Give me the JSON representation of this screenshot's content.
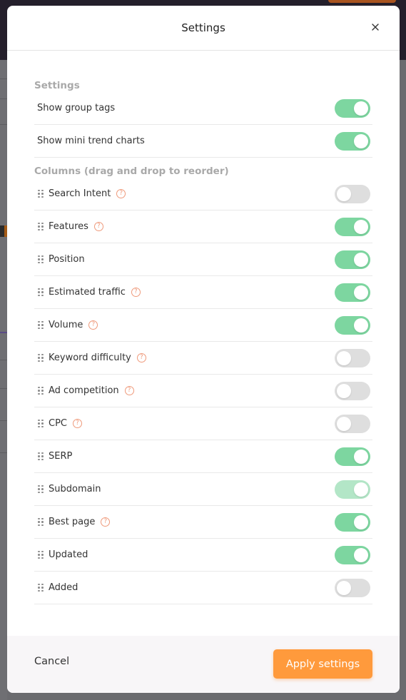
{
  "modal": {
    "title": "Settings",
    "close_icon": "close-icon"
  },
  "settings_section": {
    "title": "Settings",
    "items": [
      {
        "label": "Show group tags",
        "enabled": true
      },
      {
        "label": "Show mini trend charts",
        "enabled": true
      }
    ]
  },
  "columns_section": {
    "title": "Columns (drag and drop to reorder)",
    "items": [
      {
        "label": "Search Intent",
        "help": true,
        "enabled": false
      },
      {
        "label": "Features",
        "help": true,
        "enabled": true
      },
      {
        "label": "Position",
        "help": false,
        "enabled": true
      },
      {
        "label": "Estimated traffic",
        "help": true,
        "enabled": true
      },
      {
        "label": "Volume",
        "help": true,
        "enabled": true
      },
      {
        "label": "Keyword difficulty",
        "help": true,
        "enabled": false
      },
      {
        "label": "Ad competition",
        "help": true,
        "enabled": false
      },
      {
        "label": "CPC",
        "help": true,
        "enabled": false
      },
      {
        "label": "SERP",
        "help": false,
        "enabled": true
      },
      {
        "label": "Subdomain",
        "help": false,
        "enabled": true,
        "disabled": true
      },
      {
        "label": "Best page",
        "help": true,
        "enabled": true
      },
      {
        "label": "Updated",
        "help": false,
        "enabled": true
      },
      {
        "label": "Added",
        "help": false,
        "enabled": false
      }
    ]
  },
  "footer": {
    "cancel_label": "Cancel",
    "apply_label": "Apply settings"
  },
  "help_glyph": "?",
  "colors": {
    "toggle_on": "#7dd6a0",
    "toggle_off": "#dedede",
    "accent": "#ff9a3c",
    "help_icon": "#ef9a7b"
  }
}
